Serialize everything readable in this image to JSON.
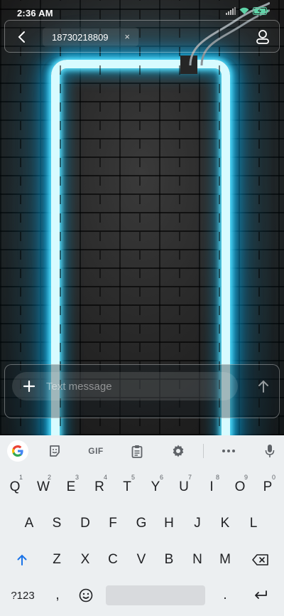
{
  "status_bar": {
    "time": "2:36 AM",
    "icons": [
      "signal-icon",
      "wifi-icon",
      "battery-charging-icon"
    ]
  },
  "header": {
    "recipient_chip": "18730218809",
    "chip_close": "×",
    "back_icon": "back-arrow-icon",
    "contact_icon": "person-icon"
  },
  "compose": {
    "placeholder": "Text message",
    "value": "",
    "add_icon": "plus-icon",
    "send_icon": "send-arrow-icon"
  },
  "keyboard": {
    "toolbar": {
      "google": "G",
      "gif": "GIF",
      "icons": [
        "google-icon",
        "sticker-icon",
        "gif-icon",
        "clipboard-icon",
        "settings-icon",
        "more-icon",
        "mic-icon"
      ]
    },
    "row1": [
      {
        "k": "Q",
        "h": "1"
      },
      {
        "k": "W",
        "h": "2"
      },
      {
        "k": "E",
        "h": "3"
      },
      {
        "k": "R",
        "h": "4"
      },
      {
        "k": "T",
        "h": "5"
      },
      {
        "k": "Y",
        "h": "6"
      },
      {
        "k": "U",
        "h": "7"
      },
      {
        "k": "I",
        "h": "8"
      },
      {
        "k": "O",
        "h": "9"
      },
      {
        "k": "P",
        "h": "0"
      }
    ],
    "row2": [
      "A",
      "S",
      "D",
      "F",
      "G",
      "H",
      "J",
      "K",
      "L"
    ],
    "row3": [
      "Z",
      "X",
      "C",
      "V",
      "B",
      "N",
      "M"
    ],
    "row4": {
      "symbols": "?123",
      "comma": ",",
      "period": "."
    }
  }
}
